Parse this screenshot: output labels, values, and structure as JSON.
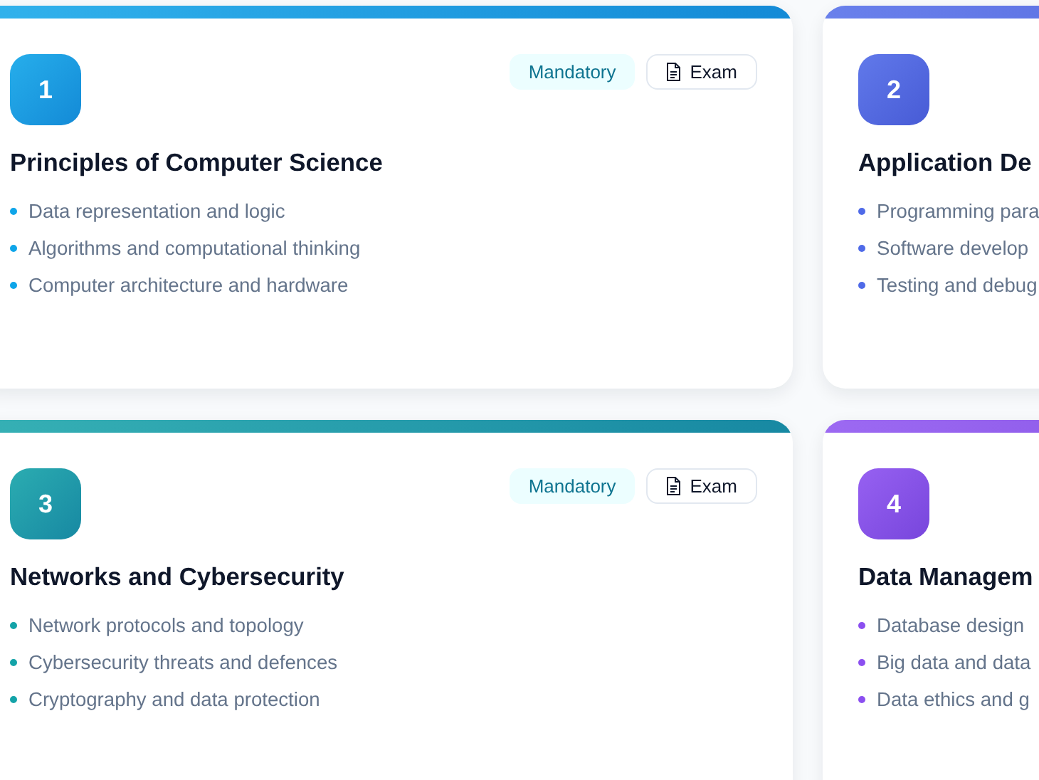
{
  "modules": [
    {
      "number": "1",
      "title": "Principles of Computer Science",
      "color": "#0ea5e9",
      "badges": [
        {
          "kind": "tag",
          "label": "Mandatory"
        },
        {
          "kind": "assessment",
          "label": "Exam"
        }
      ],
      "topics": [
        "Data representation and logic",
        "Algorithms and computational thinking",
        "Computer architecture and hardware"
      ]
    },
    {
      "number": "2",
      "title": "Application De",
      "color": "#4f6ae8",
      "topics": [
        "Programming para",
        "Software develop",
        "Testing and debug"
      ]
    },
    {
      "number": "3",
      "title": "Networks and Cybersecurity",
      "color": "#13a3a8",
      "badges": [
        {
          "kind": "tag",
          "label": "Mandatory"
        },
        {
          "kind": "assessment",
          "label": "Exam"
        }
      ],
      "topics": [
        "Network protocols and topology",
        "Cybersecurity threats and defences",
        "Cryptography and data protection"
      ]
    },
    {
      "number": "4",
      "title": "Data Managem",
      "color": "#8b4ff0",
      "topics": [
        "Database design",
        "Big data and data",
        "Data ethics and g"
      ]
    }
  ]
}
